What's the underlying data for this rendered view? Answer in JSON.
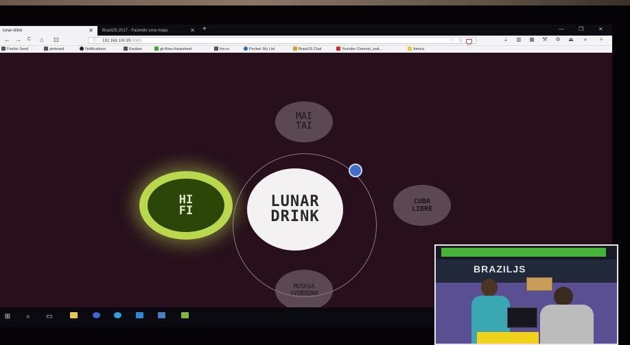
{
  "browser": {
    "tabs": [
      {
        "title": "lunar-drink",
        "close": "✕"
      },
      {
        "title": "BrazilJS 2017 - Fazendo uma maqu",
        "close": "✕"
      }
    ],
    "new_tab": "+",
    "window_controls": {
      "minimize": "—",
      "maximize": "❐",
      "close": "✕"
    },
    "nav": {
      "back": "←",
      "forward": "→",
      "reload": "C",
      "home": "⌂",
      "sidebar": "⊡"
    },
    "url": {
      "host": "192.168.100.95",
      "port": ":8080",
      "more": "···",
      "star": "☆"
    },
    "toolbar_icons": [
      "download-icon",
      "library-icon",
      "extensions-icon",
      "wrench-icon",
      "gear-icon",
      "bookmark-icon",
      "overflow-icon",
      "menu-icon"
    ],
    "bookmarks": [
      {
        "label": "Firefox Send",
        "icon_color": "#555555"
      },
      {
        "label": "pinboard",
        "icon_color": "#555555"
      },
      {
        "label": "Notifications",
        "icon_color": "#222222"
      },
      {
        "label": "Kanban",
        "icon_color": "#555555"
      },
      {
        "label": "git-flow-cheatsheet",
        "icon_color": "#3fa535"
      },
      {
        "label": "fon.ru",
        "icon_color": "#555555"
      },
      {
        "label": "Pocket: My List",
        "icon_color": "#2a6bc9"
      },
      {
        "label": "BrazilJS Chat",
        "icon_color": "#d8a21a"
      },
      {
        "label": "Youtube Channel_swit...",
        "icon_color": "#d92a2a"
      },
      {
        "label": "Amora",
        "icon_color": "#e8c84a"
      }
    ]
  },
  "app": {
    "center": "LUNAR\nDRINK",
    "selected": "HI\nFI",
    "drinks": {
      "top": "MAI\nTAI",
      "right": "CUBA\nLIBRE",
      "bottom": "MOSKVA\nSVOBODNO"
    },
    "colors": {
      "background": "#27101b",
      "selected_glow": "#b9d84e",
      "selected_fill": "#2c4608",
      "indicator": "#3f6fc9"
    }
  },
  "taskbar": {
    "items": [
      "windows-icon",
      "search-icon",
      "task-view-icon",
      "file-explorer-icon",
      "firefox-icon",
      "telegram-icon",
      "vscode-icon",
      "app-icon",
      "terminal-icon"
    ]
  },
  "webcam": {
    "banner": "BRAZILJS"
  }
}
